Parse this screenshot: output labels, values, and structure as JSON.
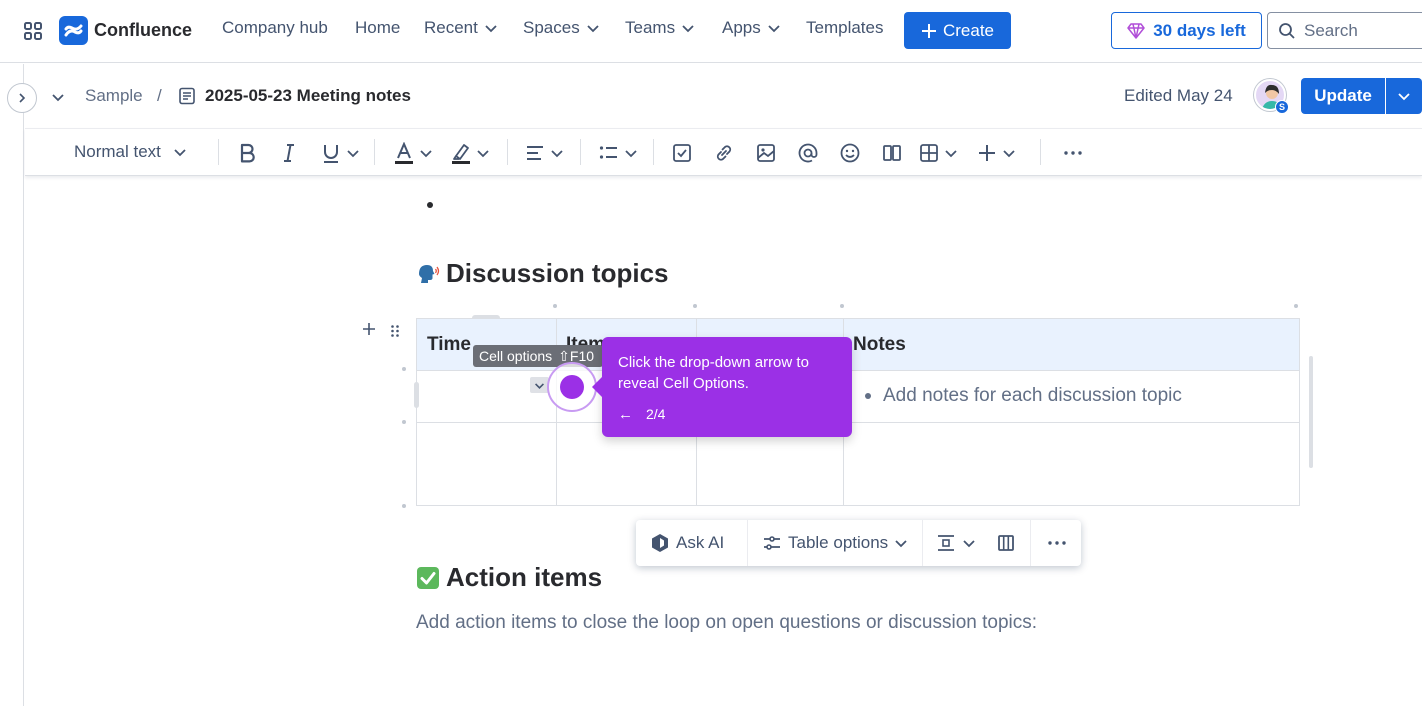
{
  "topnav": {
    "app_name": "Confluence",
    "items": [
      "Company hub",
      "Home",
      "Recent",
      "Spaces",
      "Teams",
      "Apps",
      "Templates"
    ],
    "create_label": "Create",
    "trial_label": "30 days left",
    "search_placeholder": "Search"
  },
  "breadcrumb": {
    "space": "Sample",
    "separator": "/",
    "page_title": "2025-05-23 Meeting notes",
    "edited": "Edited May 24",
    "avatar_badge": "S",
    "update_label": "Update"
  },
  "toolbar": {
    "text_style": "Normal text",
    "icons": [
      "bold-icon",
      "italic-icon",
      "underline-icon",
      "text-color-icon",
      "highlight-icon",
      "align-icon",
      "bullet-list-icon",
      "checkbox-icon",
      "link-icon",
      "image-icon",
      "mention-icon",
      "emoji-icon",
      "layout-icon",
      "table-icon",
      "insert-icon",
      "more-icon"
    ]
  },
  "content": {
    "discussion_heading": "Discussion topics",
    "table": {
      "headers": [
        "Time",
        "Item",
        "",
        "Notes"
      ],
      "notes_placeholder": "Add notes for each discussion topic"
    },
    "action_heading": "Action items",
    "action_paragraph": "Add action items to close the loop on open questions or discussion topics:"
  },
  "cell_options_tooltip": {
    "label": "Cell options",
    "shortcut": "⇧F10"
  },
  "guide": {
    "text": "Click the drop-down arrow to reveal Cell Options.",
    "back": "←",
    "step": "2/4"
  },
  "table_toolbar": {
    "ask_ai": "Ask AI",
    "table_options": "Table options"
  },
  "colors": {
    "brand_blue": "#1868db",
    "guide_purple": "#9b30e6",
    "header_bg": "#e9f2fe"
  }
}
